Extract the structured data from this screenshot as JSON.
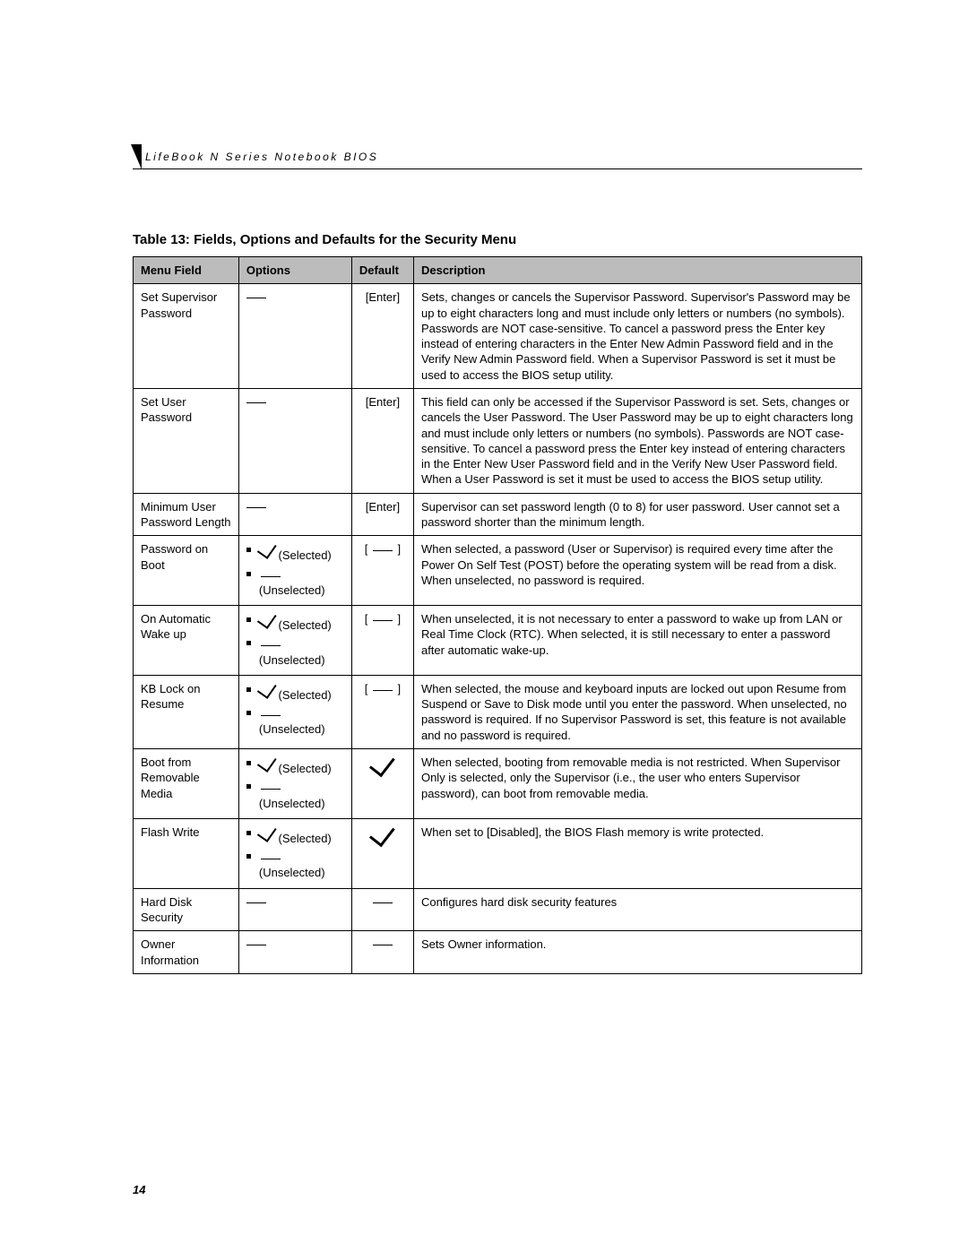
{
  "header": {
    "running_head": "LifeBook N Series Notebook BIOS"
  },
  "table": {
    "title": "Table 13: Fields, Options and Defaults for the Security Menu",
    "columns": {
      "field": "Menu Field",
      "options": "Options",
      "default": "Default",
      "description": "Description"
    },
    "option_labels": {
      "selected": "(Selected)",
      "unselected": "(Unselected)"
    },
    "rows": [
      {
        "field": "Set Supervisor Password",
        "options_type": "dash",
        "default_type": "text",
        "default": "[Enter]",
        "description": "Sets, changes or cancels the Supervisor Password. Supervisor's Password may be up to eight characters long and must include only letters or numbers (no symbols). Passwords are NOT case-sensitive. To cancel a password press the Enter key instead of entering characters in the Enter New Admin Password field and in the Verify New Admin Password field. When a Supervisor Password is set it must be used to access the BIOS setup utility."
      },
      {
        "field": "Set User Password",
        "options_type": "dash",
        "default_type": "text",
        "default": "[Enter]",
        "description": "This field can only be accessed if the Supervisor Password is set. Sets, changes or cancels the User Password. The User Password may be up to eight characters long and must include only letters or numbers (no symbols). Passwords are NOT case-sensitive. To cancel a password press the Enter key instead of entering characters in the Enter New User Password field and in the Verify New User Password field. When a User Password is set it must be used to access the BIOS setup utility."
      },
      {
        "field": "Minimum User Password Length",
        "options_type": "dash",
        "default_type": "text",
        "default": "[Enter]",
        "description": "Supervisor can set password length (0 to 8) for user password. User cannot set a password shorter than the minimum length."
      },
      {
        "field": "Password on Boot",
        "options_type": "checklist",
        "default_type": "bracket-blank",
        "default": "",
        "description": "When selected, a password (User or Supervisor) is required every time after the Power On Self Test (POST) before the operating system will be read from a disk. When unselected, no password is required."
      },
      {
        "field": "On Automatic Wake up",
        "options_type": "checklist",
        "default_type": "bracket-blank",
        "default": "",
        "description": "When unselected, it is not necessary to enter a password to wake up from LAN or Real Time Clock (RTC). When selected, it is still necessary to enter a password after automatic wake-up."
      },
      {
        "field": "KB Lock on Resume",
        "options_type": "checklist",
        "default_type": "bracket-blank",
        "default": "",
        "description": "When selected, the mouse and keyboard inputs are locked out upon Resume from Suspend or Save to Disk mode until you enter the password. When unselected, no password is required. If no Supervisor Password is set, this feature is not available and no password is required."
      },
      {
        "field": "Boot from Removable Media",
        "options_type": "checklist",
        "default_type": "check",
        "default": "",
        "description": "When selected, booting from removable media is not restricted. When Supervisor Only is selected, only the Supervisor (i.e., the user who enters Supervisor password), can boot from removable media."
      },
      {
        "field": "Flash Write",
        "options_type": "checklist",
        "default_type": "check",
        "default": "",
        "description": "When set to [Disabled], the BIOS Flash memory is write protected."
      },
      {
        "field": "Hard Disk Security",
        "options_type": "dash",
        "default_type": "dash",
        "default": "",
        "description": "Configures hard disk security features"
      },
      {
        "field": "Owner Information",
        "options_type": "dash",
        "default_type": "dash",
        "default": "",
        "description": "Sets Owner information."
      }
    ]
  },
  "page_number": "14"
}
